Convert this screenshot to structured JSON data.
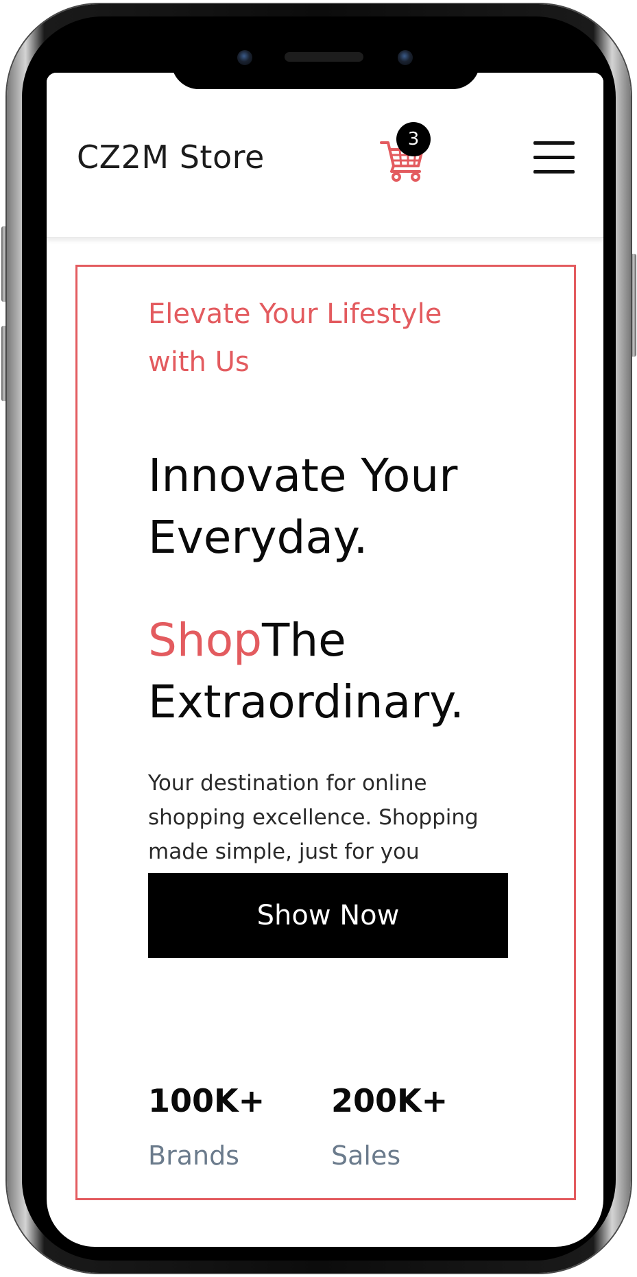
{
  "header": {
    "brand": "CZ2M Store",
    "cart_icon": "cart-icon",
    "cart_count": "3",
    "menu_icon": "hamburger-menu-icon"
  },
  "hero": {
    "tagline": "Elevate Your Lifestyle with Us",
    "headline": "Innovate Your Everyday.",
    "headline2_accent": "Shop",
    "headline2_rest": "The Extraordinary.",
    "description": "Your destination for online shopping excellence. Shopping made simple, just for you",
    "cta_label": "Show Now",
    "stats": [
      {
        "value": "100K+",
        "label": "Brands"
      },
      {
        "value": "200K+",
        "label": "Sales"
      }
    ]
  },
  "colors": {
    "accent": "#e35b5f",
    "text": "#0a0a0a",
    "muted": "#6b7b8c",
    "button": "#000000"
  }
}
